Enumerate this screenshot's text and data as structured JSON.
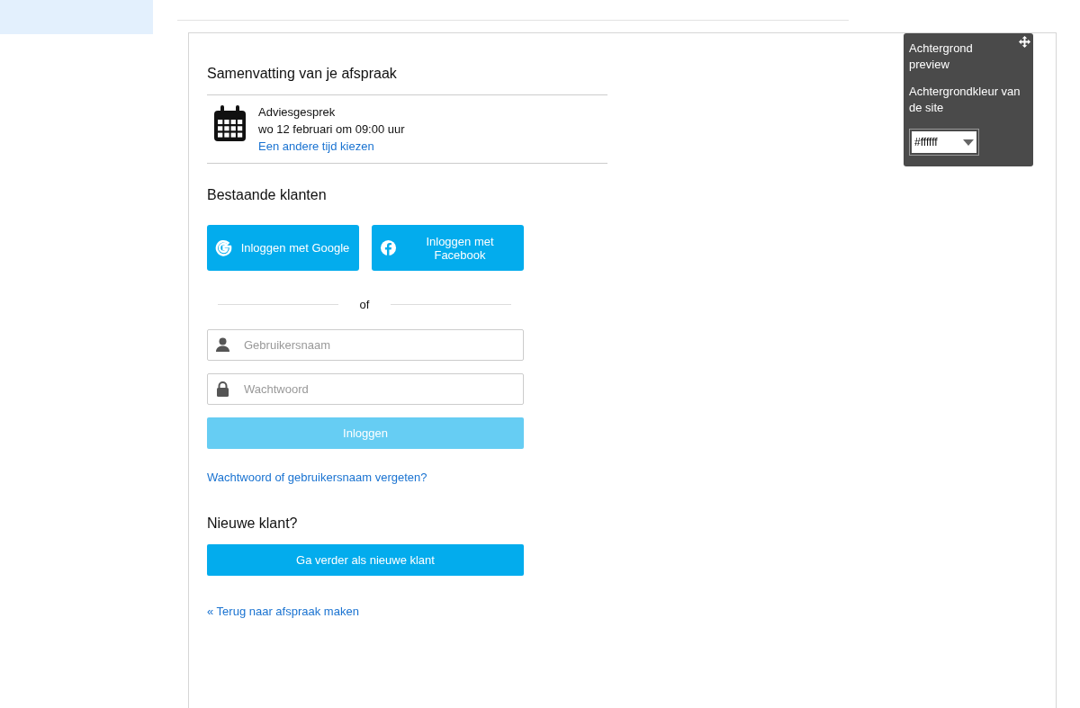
{
  "summary": {
    "title": "Samenvatting van je afspraak",
    "service": "Adviesgesprek",
    "datetime": "wo 12 februari om 09:00 uur",
    "change_link": "Een andere tijd kiezen"
  },
  "existing": {
    "title": "Bestaande klanten",
    "social_buttons": [
      {
        "kind": "google",
        "label": "Inloggen met Google"
      },
      {
        "kind": "facebook",
        "label": "Inloggen met Facebook"
      }
    ],
    "separator": "of",
    "fields": [
      {
        "kind": "user",
        "placeholder": "Gebruikersnaam"
      },
      {
        "kind": "lock",
        "placeholder": "Wachtwoord"
      }
    ],
    "login_button": {
      "label": "Inloggen",
      "disabled": true
    },
    "forgot_link": "Wachtwoord of gebruikersnaam vergeten?"
  },
  "new_customer": {
    "title": "Nieuwe klant?",
    "button": "Ga verder als nieuwe klant"
  },
  "back_link": "« Terug naar afspraak maken",
  "preview_panel": {
    "title": "Achtergrond preview",
    "label": "Achtergrondkleur van de site",
    "value": "#ffffff"
  }
}
